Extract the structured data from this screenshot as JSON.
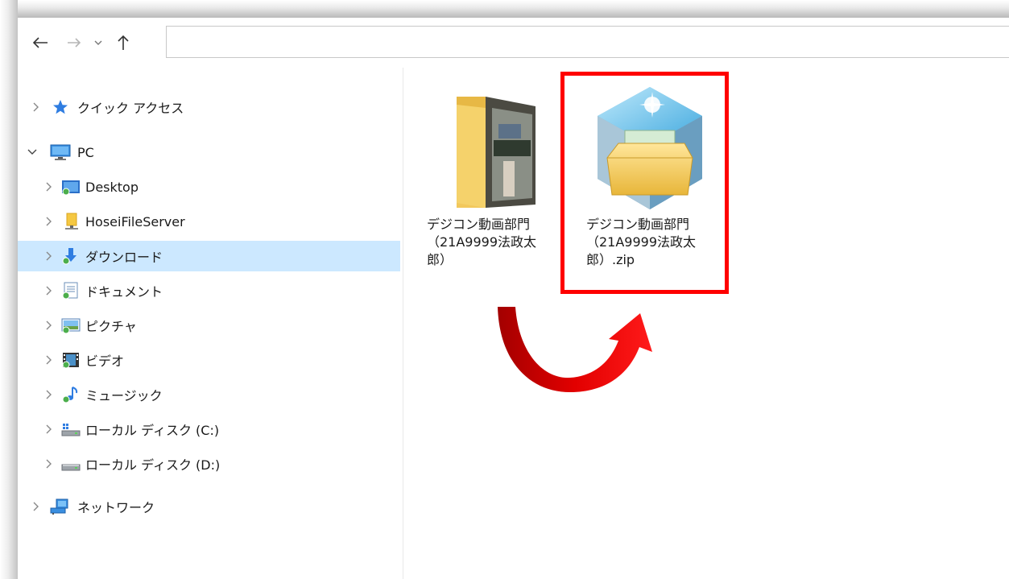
{
  "navigation": {
    "back_icon": "arrow-left-icon",
    "forward_icon": "arrow-right-icon",
    "recent_icon": "chevron-down-icon",
    "up_icon": "arrow-up-icon",
    "address": ""
  },
  "sidebar": {
    "items": [
      {
        "label": "クイック アクセス",
        "icon": "star-icon",
        "expand": "collapsed"
      },
      {
        "label": "PC",
        "icon": "computer-icon",
        "expand": "expanded"
      },
      {
        "label": "Desktop",
        "icon": "desktop-folder-icon",
        "expand": "collapsed"
      },
      {
        "label": "HoseiFileServer",
        "icon": "network-folder-icon",
        "expand": "collapsed"
      },
      {
        "label": "ダウンロード",
        "icon": "downloads-folder-icon",
        "expand": "collapsed",
        "selected": true
      },
      {
        "label": "ドキュメント",
        "icon": "documents-folder-icon",
        "expand": "collapsed"
      },
      {
        "label": "ピクチャ",
        "icon": "pictures-folder-icon",
        "expand": "collapsed"
      },
      {
        "label": "ビデオ",
        "icon": "videos-folder-icon",
        "expand": "collapsed"
      },
      {
        "label": "ミュージック",
        "icon": "music-folder-icon",
        "expand": "collapsed"
      },
      {
        "label": "ローカル ディスク (C:)",
        "icon": "system-drive-icon",
        "expand": "collapsed"
      },
      {
        "label": "ローカル ディスク (D:)",
        "icon": "drive-icon",
        "expand": "collapsed"
      },
      {
        "label": "ネットワーク",
        "icon": "network-icon",
        "expand": "collapsed"
      }
    ]
  },
  "files": [
    {
      "lines": [
        "デジコン動画部門",
        "（21A9999法政太",
        "郎）"
      ],
      "icon": "photo-folder-icon"
    },
    {
      "lines": [
        "デジコン動画部門",
        "（21A9999法政太",
        "郎）.zip"
      ],
      "icon": "zip-archive-icon"
    }
  ],
  "annotation": {
    "arrow_icon": "curved-arrow-icon",
    "arrow_color": "#e00000",
    "highlight_color": "#ff0000"
  },
  "colors": {
    "selection": "#cce8ff",
    "folder": "#f5d26b"
  }
}
